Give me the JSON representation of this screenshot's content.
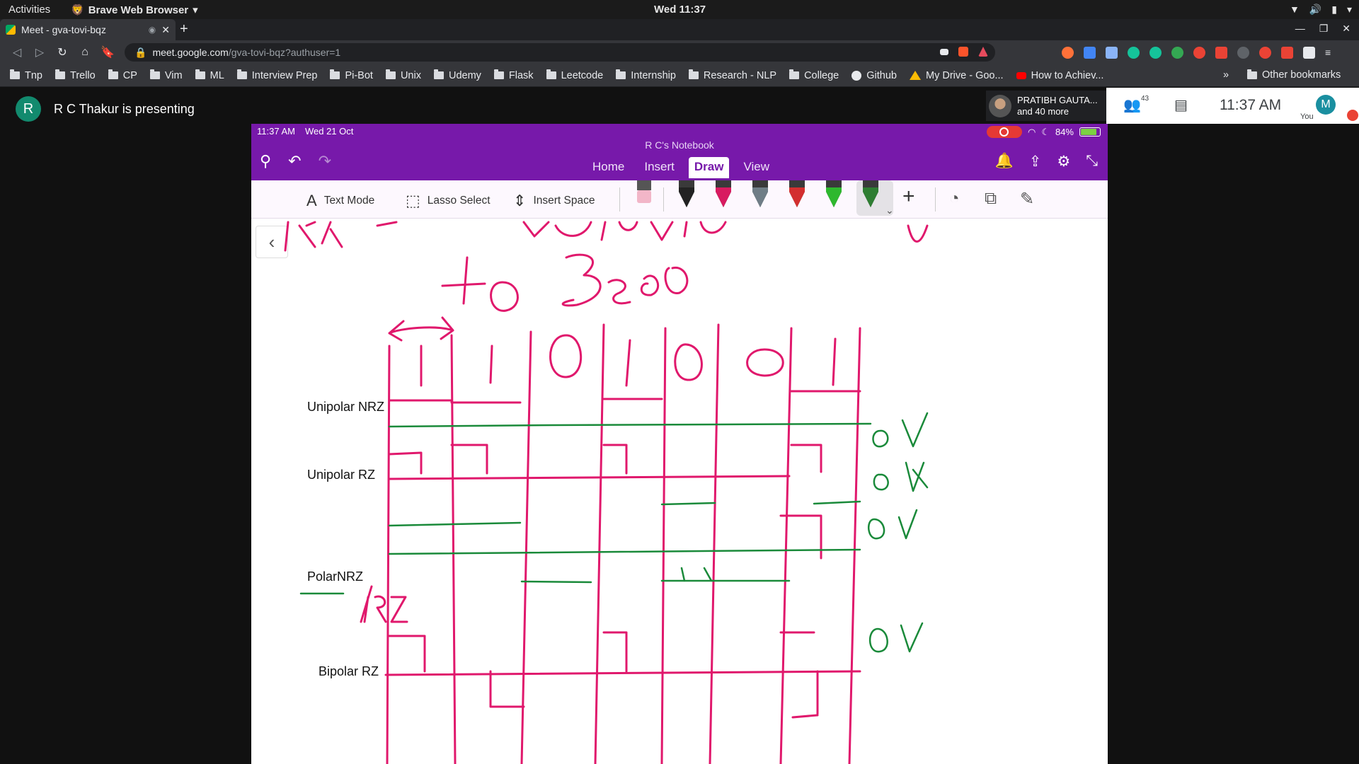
{
  "os_bar": {
    "activities": "Activities",
    "app": "Brave Web Browser",
    "clock": "Wed 11:37"
  },
  "browser": {
    "tab_title": "Meet - gva-tovi-bqz",
    "url_host": "meet.google.com",
    "url_path": "/gva-tovi-bqz?authuser=1",
    "bookmarks": [
      "Tnp",
      "Trello",
      "CP",
      "Vim",
      "ML",
      "Interview Prep",
      "Pi-Bot",
      "Unix",
      "Udemy",
      "Flask",
      "Leetcode",
      "Internship",
      "Research - NLP",
      "College",
      "Github",
      "My Drive - Goo...",
      "How to Achiev..."
    ],
    "other_bookmarks": "Other bookmarks",
    "more": "»"
  },
  "meet": {
    "presenter_initial": "R",
    "presenter_text": "R C Thakur is presenting",
    "participant_name": "PRATIBH GAUTA...",
    "participant_more": "and 40 more",
    "people_count": "43",
    "time": "11:37  AM",
    "me_initial": "M",
    "you_label": "You"
  },
  "ipad": {
    "status_time": "11:37 AM",
    "status_date": "Wed 21 Oct",
    "battery": "84%",
    "notebook": "R C's Notebook",
    "tabs": [
      "Home",
      "Insert",
      "Draw",
      "View"
    ],
    "active_tab": "Draw",
    "toolbar": {
      "text_mode": "Text Mode",
      "lasso": "Lasso Select",
      "insert_space": "Insert Space"
    },
    "pen_colors": [
      "#222222",
      "#d81b60",
      "#6f7d86",
      "#d32f2f",
      "#2eb82e",
      "#2e7d32"
    ]
  },
  "canvas": {
    "row_labels": [
      "Unipolar NRZ",
      "Unipolar RZ",
      "PolarNRZ",
      "Bipolar RZ"
    ],
    "ink_pink": "#e0186c",
    "ink_green": "#1a8a3a"
  }
}
